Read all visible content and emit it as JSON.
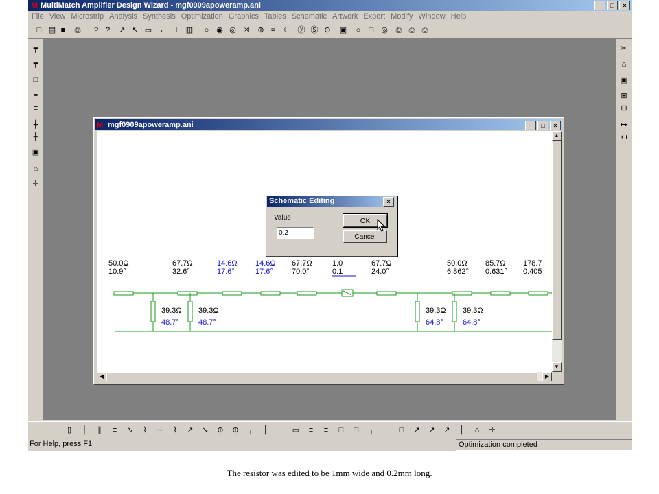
{
  "app": {
    "title": "MultiMatch Amplifier Design Wizard - mgf0909apoweramp.ani",
    "icon": "multimatch-logo-icon",
    "window_buttons": [
      "_",
      "□",
      "×"
    ]
  },
  "menu": [
    "File",
    "View",
    "Microstrip",
    "Analysis",
    "Synthesis",
    "Optimization",
    "Graphics",
    "Tables",
    "Schematic",
    "Artwork",
    "Export",
    "Modify",
    "Window",
    "Help"
  ],
  "child_window": {
    "title": "mgf0909apoweramp.ani"
  },
  "dialog": {
    "title": "Schematic Editing",
    "close": "×",
    "value_label": "Value",
    "value": "0.2",
    "ok_label": "OK",
    "cancel_label": "Cancel"
  },
  "schematic": {
    "series_elements": [
      {
        "line1": "50.0Ω",
        "line2": "10.9°",
        "color": "black"
      },
      {
        "line1": "67.7Ω",
        "line2": "32.6°",
        "color": "black"
      },
      {
        "line1": "14.6Ω",
        "line2": "17.6°",
        "color": "blue"
      },
      {
        "line1": "14.6Ω",
        "line2": "17.6°",
        "color": "blue"
      },
      {
        "line1": "67.7Ω",
        "line2": "70.0°",
        "color": "black"
      },
      {
        "line1": "1.0",
        "line2": "0.1",
        "color": "black"
      },
      {
        "line1": "67.7Ω",
        "line2": "24.0°",
        "color": "black"
      },
      {
        "line1": "50.0Ω",
        "line2": "6.862°",
        "color": "black"
      },
      {
        "line1": "85.7Ω",
        "line2": "0.631°",
        "color": "black"
      },
      {
        "line1": "178.7",
        "line2": "0.405",
        "color": "black"
      }
    ],
    "stubs": [
      {
        "line1": "39.3Ω",
        "line2": "48.7°"
      },
      {
        "line1": "39.3Ω",
        "line2": "48.7°"
      },
      {
        "line1": "39.3Ω",
        "line2": "64.8°"
      },
      {
        "line1": "39.3Ω",
        "line2": "64.8°"
      }
    ],
    "line_color": "#1a9a1a",
    "value_black": "#000000",
    "value_blue": "#1414d8"
  },
  "status": {
    "help": "For Help, press F1",
    "message": "Optimization completed"
  },
  "toolbar_top_icons": [
    "new-file-icon",
    "open-folder-icon",
    "save-icon",
    "print-icon",
    "help-icon",
    "context-help-icon",
    "arrow-tool-icon",
    "arrow-tool-2-icon",
    "dimension-icon",
    "microstrip-bend-icon",
    "tee-icon",
    "resistor-icon",
    "circle-icon",
    "circle-2-icon",
    "circle-3-icon",
    "box-x-icon",
    "component-icon",
    "equals-icon",
    "loop-icon",
    "y-icon",
    "s-icon",
    "dot-icon",
    "chip-icon",
    "circle-4-icon",
    "square-icon",
    "circle-5-icon",
    "print-stack-icon",
    "print-stack-2-icon",
    "print-stack-3-icon"
  ],
  "toolbar_top_glyphs": [
    "□",
    "▤",
    "■",
    "⎙",
    "?",
    "?",
    "↗",
    "↖",
    "▭",
    "⌐",
    "⊤",
    "▥",
    "○",
    "◉",
    "◎",
    "☒",
    "⊕",
    "=",
    "☾",
    "ⓨ",
    "Ⓢ",
    "⊙",
    "▣",
    "○",
    "□",
    "◎",
    "⎙",
    "⎙",
    "⎙"
  ],
  "toolbar_left_glyphs": [
    "┳",
    "┳",
    "□",
    "≡",
    "≡",
    "╋",
    "╋",
    "▣",
    "⌂",
    "✛"
  ],
  "toolbar_right_glyphs": [
    "✂",
    "⌂",
    "▣",
    "⊞",
    "⊟",
    "↦",
    "↤"
  ],
  "toolbar_bottom_glyphs": [
    "─",
    "│",
    "▯",
    "┤",
    "∥",
    "≡",
    "∿",
    "⌇",
    "∼",
    "⌇",
    "↗",
    "↘",
    "⊕",
    "⊕",
    "┐",
    "│",
    "─",
    "▭",
    "≡",
    "≡",
    "□",
    "□",
    "┐",
    "─",
    "□",
    "↗",
    "↗",
    "↗",
    "│",
    "⌂",
    "✛"
  ],
  "caption": "The resistor was edited to be 1mm wide and 0.2mm long."
}
